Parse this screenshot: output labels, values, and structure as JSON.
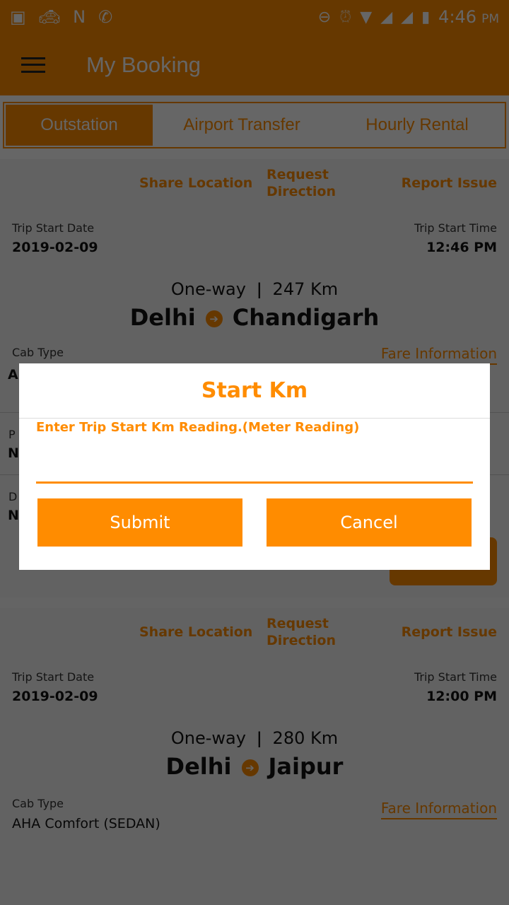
{
  "status_bar": {
    "time": "4:46",
    "ampm": "PM",
    "icons_left": [
      "image-icon",
      "taxi-icon",
      "n-icon",
      "call-forward-icon"
    ],
    "icons_right": [
      "dnd-icon",
      "alarm-icon",
      "wifi-icon",
      "signal-icon",
      "signal-icon",
      "battery-charging-icon"
    ]
  },
  "header": {
    "title": "My Booking"
  },
  "tabs": [
    {
      "label": "Outstation",
      "active": true
    },
    {
      "label": "Airport Transfer"
    },
    {
      "label": "Hourly Rental"
    }
  ],
  "bookings": [
    {
      "share": "Share Location",
      "request": "Request Direction",
      "report": "Report Issue",
      "start_date_label": "Trip Start Date",
      "start_date": "2019-02-09",
      "start_time_label": "Trip Start Time",
      "start_time": "12:46 PM",
      "trip_type": "One-way",
      "distance": "247 Km",
      "from": "Delhi",
      "to": "Chandigarh",
      "cab_type_label": "Cab Type",
      "cab_type": "A",
      "fare": "Fare Information",
      "hidden_fragments": [
        "P",
        "N",
        "D",
        "N"
      ]
    },
    {
      "share": "Share Location",
      "request": "Request Direction",
      "report": "Report Issue",
      "start_date_label": "Trip Start Date",
      "start_date": "2019-02-09",
      "start_time_label": "Trip Start Time",
      "start_time": "12:00 PM",
      "trip_type": "One-way",
      "distance": "280 Km",
      "from": "Delhi",
      "to": "Jaipur",
      "cab_type_label": "Cab Type",
      "cab_type": "AHA Comfort (SEDAN)",
      "fare": "Fare Information"
    }
  ],
  "dialog": {
    "title": "Start Km",
    "hint": "Enter Trip Start Km Reading.(Meter Reading)",
    "input_value": "",
    "submit": "Submit",
    "cancel": "Cancel"
  },
  "colors": {
    "accent": "#ff8c00"
  }
}
